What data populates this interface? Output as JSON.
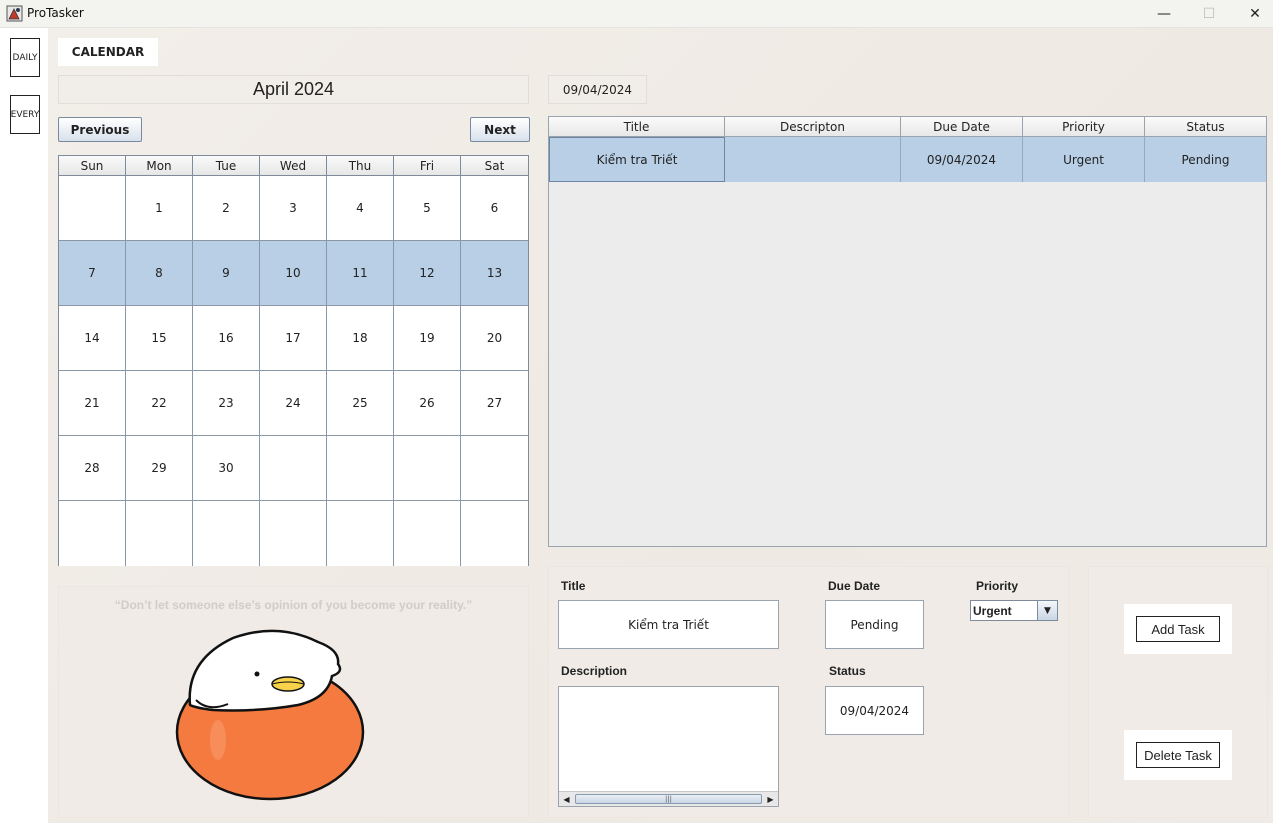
{
  "window": {
    "title": "ProTasker",
    "minimize_glyph": "—",
    "maximize_glyph": "☐",
    "close_glyph": "✕"
  },
  "left_rail": {
    "items": [
      {
        "label": "DAILY"
      },
      {
        "label": "EVERY"
      }
    ]
  },
  "tabs": [
    {
      "label": "CALENDAR",
      "active": true
    }
  ],
  "calendar": {
    "month_label": "April 2024",
    "prev_label": "Previous",
    "next_label": "Next",
    "weekdays": [
      "Sun",
      "Mon",
      "Tue",
      "Wed",
      "Thu",
      "Fri",
      "Sat"
    ],
    "weeks": [
      [
        "",
        "1",
        "2",
        "3",
        "4",
        "5",
        "6"
      ],
      [
        "7",
        "8",
        "9",
        "10",
        "11",
        "12",
        "13"
      ],
      [
        "14",
        "15",
        "16",
        "17",
        "18",
        "19",
        "20"
      ],
      [
        "21",
        "22",
        "23",
        "24",
        "25",
        "26",
        "27"
      ],
      [
        "28",
        "29",
        "30",
        "",
        "",
        "",
        ""
      ],
      [
        "",
        "",
        "",
        "",
        "",
        "",
        ""
      ]
    ],
    "selected_week": 1,
    "selection_color": "#b8cfe6"
  },
  "quote": {
    "text": "“Don’t let someone else’s opinion of you become your reality.”"
  },
  "selected_date": "09/04/2024",
  "task_table": {
    "columns": [
      "Title",
      "Descripton",
      "Due Date",
      "Priority",
      "Status"
    ],
    "rows": [
      [
        "Kiểm tra Triết",
        "",
        "09/04/2024",
        "Urgent",
        "Pending"
      ]
    ]
  },
  "form": {
    "title_label": "Title",
    "title_value": "Kiểm tra Triết",
    "due_label": "Due Date",
    "due_value": "Pending",
    "priority_label": "Priority",
    "priority_value": "Urgent",
    "description_label": "Description",
    "description_value": "",
    "status_label": "Status",
    "status_value": "09/04/2024",
    "scroll_grip": "|||"
  },
  "actions": {
    "add_label": "Add Task",
    "delete_label": "Delete Task"
  },
  "colors": {
    "background": "#f0ebe6",
    "selection": "#b8cfe6",
    "mascot_body": "#f47a40",
    "mascot_head": "#ffffff",
    "mascot_beak": "#f8d24a"
  }
}
